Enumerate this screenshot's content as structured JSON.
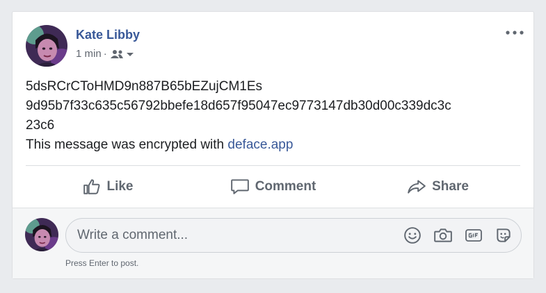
{
  "post": {
    "author": "Kate Libby",
    "timestamp": "1 min",
    "separator": "·",
    "audience_icon": "friends-icon",
    "body_line1": "5dsRCrCToHMD9n887B65bEZujCM1Es",
    "body_line2": "9d95b7f33c635c56792bbefe18d657f95047ec9773147db30d00c339dc3c",
    "body_line3": "23c6",
    "body_line4_prefix": "This message was encrypted with ",
    "body_link": "deface.app"
  },
  "actions": {
    "like": "Like",
    "comment": "Comment",
    "share": "Share"
  },
  "composer": {
    "placeholder": "Write a comment...",
    "hint": "Press Enter to post.",
    "icons": [
      "emoji-icon",
      "camera-icon",
      "gif-icon",
      "sticker-icon"
    ]
  },
  "colors": {
    "link": "#385898",
    "background": "#e9ebee",
    "text": "#1c1e21",
    "muted": "#606770"
  }
}
